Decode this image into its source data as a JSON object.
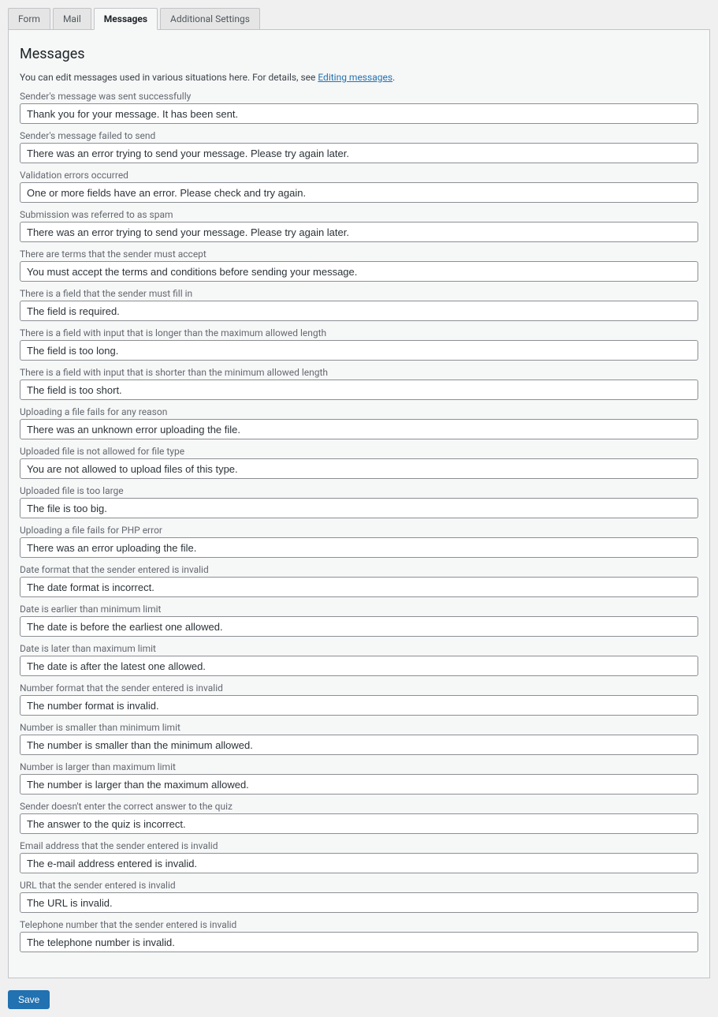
{
  "tabs": {
    "form": "Form",
    "mail": "Mail",
    "messages": "Messages",
    "additional": "Additional Settings"
  },
  "panel": {
    "title": "Messages",
    "desc_before": "You can edit messages used in various situations here. For details, see ",
    "desc_link": "Editing messages",
    "desc_after": "."
  },
  "fields": [
    {
      "label": "Sender's message was sent successfully",
      "value": "Thank you for your message. It has been sent."
    },
    {
      "label": "Sender's message failed to send",
      "value": "There was an error trying to send your message. Please try again later."
    },
    {
      "label": "Validation errors occurred",
      "value": "One or more fields have an error. Please check and try again."
    },
    {
      "label": "Submission was referred to as spam",
      "value": "There was an error trying to send your message. Please try again later."
    },
    {
      "label": "There are terms that the sender must accept",
      "value": "You must accept the terms and conditions before sending your message."
    },
    {
      "label": "There is a field that the sender must fill in",
      "value": "The field is required."
    },
    {
      "label": "There is a field with input that is longer than the maximum allowed length",
      "value": "The field is too long."
    },
    {
      "label": "There is a field with input that is shorter than the minimum allowed length",
      "value": "The field is too short."
    },
    {
      "label": "Uploading a file fails for any reason",
      "value": "There was an unknown error uploading the file."
    },
    {
      "label": "Uploaded file is not allowed for file type",
      "value": "You are not allowed to upload files of this type."
    },
    {
      "label": "Uploaded file is too large",
      "value": "The file is too big."
    },
    {
      "label": "Uploading a file fails for PHP error",
      "value": "There was an error uploading the file."
    },
    {
      "label": "Date format that the sender entered is invalid",
      "value": "The date format is incorrect."
    },
    {
      "label": "Date is earlier than minimum limit",
      "value": "The date is before the earliest one allowed."
    },
    {
      "label": "Date is later than maximum limit",
      "value": "The date is after the latest one allowed."
    },
    {
      "label": "Number format that the sender entered is invalid",
      "value": "The number format is invalid."
    },
    {
      "label": "Number is smaller than minimum limit",
      "value": "The number is smaller than the minimum allowed."
    },
    {
      "label": "Number is larger than maximum limit",
      "value": "The number is larger than the maximum allowed."
    },
    {
      "label": "Sender doesn't enter the correct answer to the quiz",
      "value": "The answer to the quiz is incorrect."
    },
    {
      "label": "Email address that the sender entered is invalid",
      "value": "The e-mail address entered is invalid."
    },
    {
      "label": "URL that the sender entered is invalid",
      "value": "The URL is invalid."
    },
    {
      "label": "Telephone number that the sender entered is invalid",
      "value": "The telephone number is invalid."
    }
  ],
  "actions": {
    "save": "Save"
  }
}
